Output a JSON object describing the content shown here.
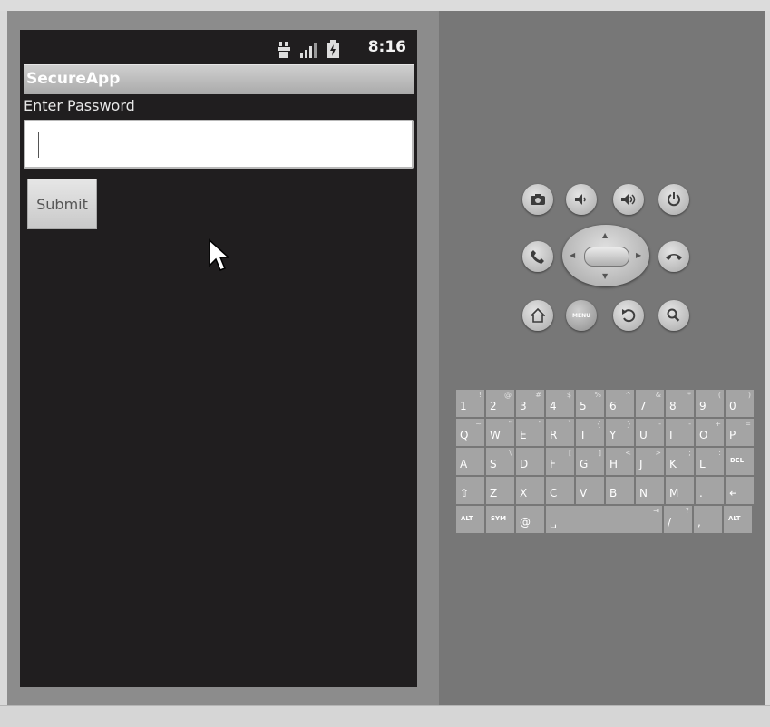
{
  "status_bar": {
    "time": "8:16"
  },
  "app": {
    "title": "SecureApp"
  },
  "form": {
    "label": "Enter Password",
    "password_value": "",
    "submit_label": "Submit"
  },
  "controls": {
    "camera": "camera-icon",
    "volume_down": "volume-down-icon",
    "volume_up": "volume-up-icon",
    "power": "power-icon",
    "call": "call-icon",
    "end_call": "end-call-icon",
    "home": "home-icon",
    "menu_label": "MENU",
    "back": "back-icon",
    "search": "search-icon"
  },
  "keyboard": {
    "row1": [
      {
        "p": "1",
        "s": "!"
      },
      {
        "p": "2",
        "s": "@"
      },
      {
        "p": "3",
        "s": "#"
      },
      {
        "p": "4",
        "s": "$"
      },
      {
        "p": "5",
        "s": "%"
      },
      {
        "p": "6",
        "s": "^"
      },
      {
        "p": "7",
        "s": "&"
      },
      {
        "p": "8",
        "s": "*"
      },
      {
        "p": "9",
        "s": "("
      },
      {
        "p": "0",
        "s": ")"
      }
    ],
    "row2": [
      {
        "p": "Q",
        "s": "~"
      },
      {
        "p": "W",
        "s": "\""
      },
      {
        "p": "E",
        "s": "\""
      },
      {
        "p": "R",
        "s": "`"
      },
      {
        "p": "T",
        "s": "{"
      },
      {
        "p": "Y",
        "s": "}"
      },
      {
        "p": "U",
        "s": "-"
      },
      {
        "p": "I",
        "s": "-"
      },
      {
        "p": "O",
        "s": "+"
      },
      {
        "p": "P",
        "s": "="
      }
    ],
    "row3": [
      {
        "p": "A",
        "s": ""
      },
      {
        "p": "S",
        "s": "\\"
      },
      {
        "p": "D",
        "s": ""
      },
      {
        "p": "F",
        "s": "["
      },
      {
        "p": "G",
        "s": "]"
      },
      {
        "p": "H",
        "s": "<"
      },
      {
        "p": "J",
        "s": ">"
      },
      {
        "p": "K",
        "s": ";"
      },
      {
        "p": "L",
        "s": ":"
      },
      {
        "p": "DEL",
        "s": ""
      }
    ],
    "row4": [
      {
        "p": "⇧",
        "s": ""
      },
      {
        "p": "Z",
        "s": ""
      },
      {
        "p": "X",
        "s": ""
      },
      {
        "p": "C",
        "s": ""
      },
      {
        "p": "V",
        "s": ""
      },
      {
        "p": "B",
        "s": ""
      },
      {
        "p": "N",
        "s": ""
      },
      {
        "p": "M",
        "s": ""
      },
      {
        "p": ".",
        "s": ""
      },
      {
        "p": "↵",
        "s": ""
      }
    ],
    "row5": [
      {
        "p": "ALT",
        "s": ""
      },
      {
        "p": "SYM",
        "s": ""
      },
      {
        "p": "@",
        "s": ""
      },
      {
        "p": "␣",
        "s": "⇥",
        "wide": true
      },
      {
        "p": "/",
        "s": "?"
      },
      {
        "p": ",",
        "s": ""
      },
      {
        "p": "ALT",
        "s": ""
      }
    ]
  }
}
